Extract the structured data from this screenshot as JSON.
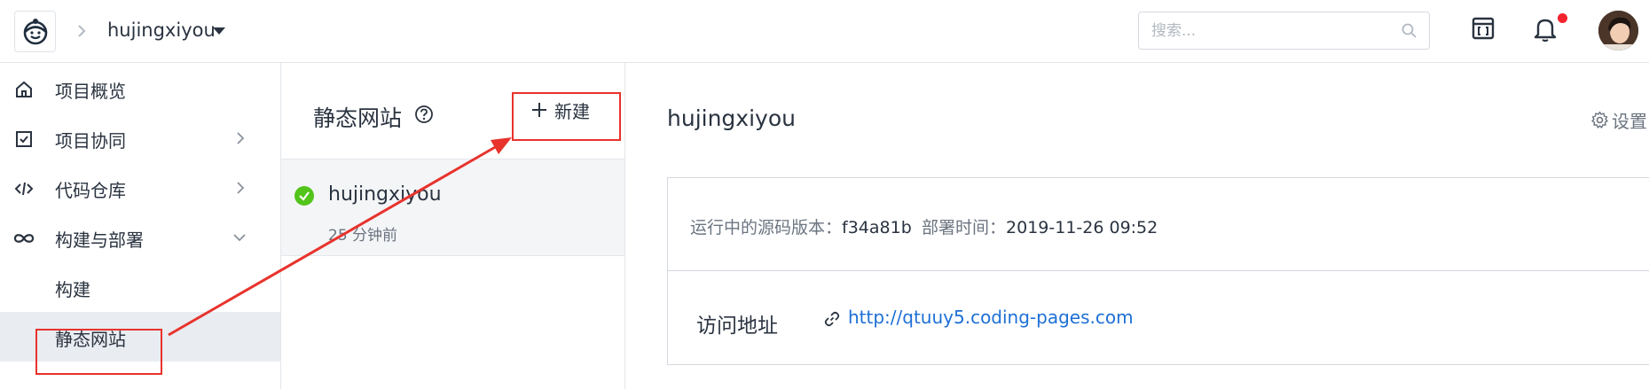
{
  "header": {
    "project_name": "hujingxiyou",
    "search_placeholder": "搜索...",
    "icons": [
      "logo-icon",
      "chevron-right-icon",
      "caret-down-icon",
      "search-icon",
      "calendar-icon",
      "bell-icon",
      "avatar"
    ],
    "notification_dot_color": "#f5222d"
  },
  "sidebar": {
    "items": [
      {
        "label": "项目概览",
        "icon": "home-icon"
      },
      {
        "label": "项目协同",
        "icon": "checkbox-icon"
      },
      {
        "label": "代码仓库",
        "icon": "code-icon"
      },
      {
        "label": "构建与部署",
        "icon": "infinity-icon"
      },
      {
        "label": "构建"
      },
      {
        "label": "静态网站",
        "active": true
      }
    ]
  },
  "list": {
    "title": "静态网站",
    "new_label": "新建",
    "site": {
      "name": "hujingxiyou",
      "time": "25 分钟前",
      "status": "success"
    }
  },
  "detail": {
    "title": "hujingxiyou",
    "settings_label": "设置",
    "version_key": "运行中的源码版本：",
    "version_value": "f34a81b",
    "deploy_key": "部署时间：",
    "deploy_value": "2019-11-26 09:52",
    "access_label": "访问地址",
    "access_url": "http://qtuuy5.coding-pages.com"
  },
  "colors": {
    "accent_link": "#1d6fd6",
    "success": "#52c41a",
    "annotation": "#e8322c",
    "active_bg": "#e9ecf1"
  }
}
